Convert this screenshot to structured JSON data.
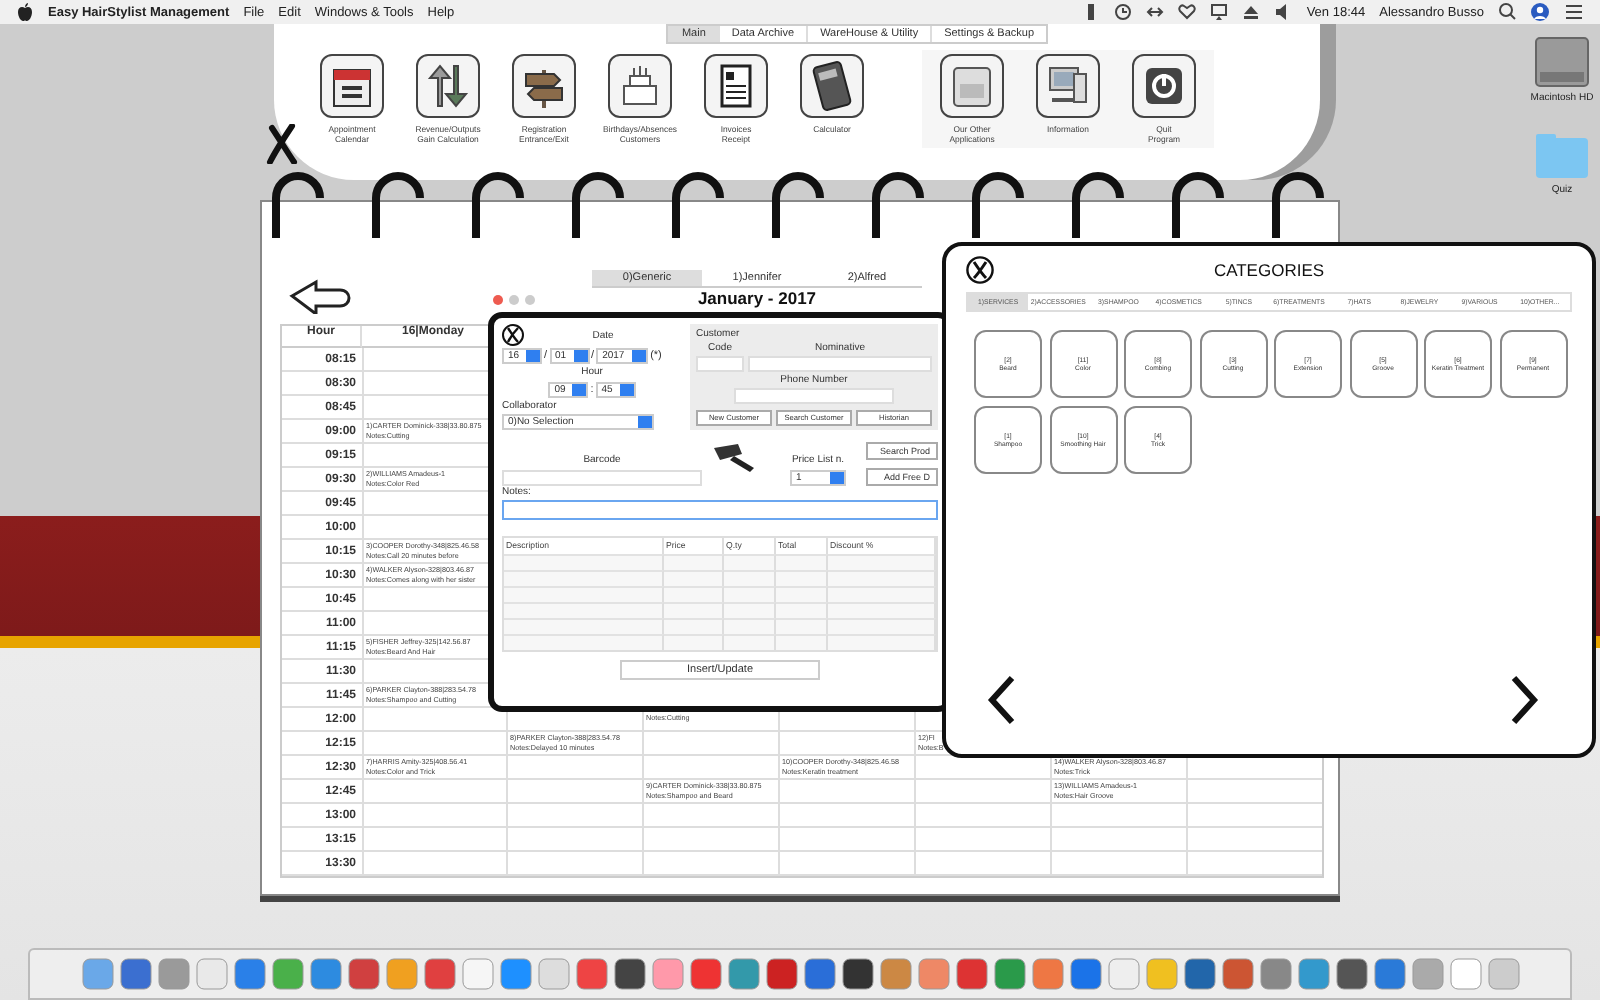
{
  "menubar": {
    "app": "Easy HairStylist Management",
    "menus": [
      "File",
      "Edit",
      "Windows & Tools",
      "Help"
    ],
    "clock": "Ven 18:44",
    "user": "Alessandro Busso"
  },
  "toolbar": {
    "tabs": [
      {
        "label": "Main",
        "selected": true
      },
      {
        "label": "Data Archive",
        "selected": false
      },
      {
        "label": "WareHouse & Utility",
        "selected": false
      },
      {
        "label": "Settings & Backup",
        "selected": false
      }
    ],
    "groups": [
      [
        {
          "lines": [
            "Appointment",
            "Calendar"
          ]
        },
        {
          "lines": [
            "Revenue/Outputs",
            "Gain Calculation"
          ]
        },
        {
          "lines": [
            "Registration",
            "Entrance/Exit"
          ]
        },
        {
          "lines": [
            "Birthdays/Absences",
            "Customers"
          ]
        },
        {
          "lines": [
            "Invoices",
            "Receipt"
          ]
        },
        {
          "lines": [
            "Calculator"
          ]
        }
      ],
      [
        {
          "lines": [
            "Our Other",
            "Applications"
          ]
        },
        {
          "lines": [
            "Information"
          ]
        },
        {
          "lines": [
            "Quit",
            "Program"
          ]
        }
      ]
    ]
  },
  "desktop_icons": [
    {
      "label": "Macintosh HD"
    },
    {
      "label": "Quiz"
    }
  ],
  "calendar": {
    "tabs": [
      {
        "label": "0)Generic",
        "selected": true
      },
      {
        "label": "1)Jennifer",
        "selected": false
      },
      {
        "label": "2)Alfred",
        "selected": false
      }
    ],
    "title": "January - 2017",
    "columns": [
      "Hour",
      "16|Monday"
    ],
    "rows": [
      {
        "hour": "08:15"
      },
      {
        "hour": "08:30"
      },
      {
        "hour": "08:45"
      },
      {
        "hour": "09:00",
        "column_2": {
          "name": "1)CARTER Dominick-338|33.80.875",
          "notes": "Notes:Cutting"
        }
      },
      {
        "hour": "09:15"
      },
      {
        "hour": "09:30",
        "column_2": {
          "name": "2)WILLIAMS Amadeus-1",
          "notes": "Notes:Color Red"
        }
      },
      {
        "hour": "09:45"
      },
      {
        "hour": "10:00"
      },
      {
        "hour": "10:15",
        "column_2": {
          "name": "3)COOPER Dorothy-348|825.46.58",
          "notes": "Notes:Call 20 minutes before"
        }
      },
      {
        "hour": "10:30",
        "column_2": {
          "name": "4)WALKER Alyson-328|803.46.87",
          "notes": "Notes:Comes along with her sister"
        }
      },
      {
        "hour": "10:45"
      },
      {
        "hour": "11:00"
      },
      {
        "hour": "11:15",
        "column_2": {
          "name": "5)FISHER Jeffrey-325|142.56.87",
          "notes": "Notes:Beard And Hair"
        }
      },
      {
        "hour": "11:30"
      },
      {
        "hour": "11:45",
        "column_2": {
          "name": "6)PARKER Clayton-388|283.54.78",
          "notes": "Notes:Shampoo and Cutting"
        }
      },
      {
        "hour": "12:00",
        "column_4": {
          "notes": "Notes:Cutting"
        }
      },
      {
        "hour": "12:15",
        "column_3": {
          "name": "8)PARKER Clayton-388|283.54.78",
          "notes": "Notes:Delayed 10 minutes"
        },
        "column_6": {
          "name": "12)FI",
          "notes": "Notes:B"
        }
      },
      {
        "hour": "12:30",
        "column_2": {
          "name": "7)HARRIS Amity-325|408.56.41",
          "notes": "Notes:Color and Trick"
        },
        "column_5": {
          "name": "10)COOPER Dorothy-348|825.46.58",
          "notes": "Notes:Keratin treatment"
        },
        "column_7": {
          "name": "14)WALKER Alyson-328|803.46.87",
          "notes": "Notes:Trick"
        }
      },
      {
        "hour": "12:45",
        "column_4": {
          "name": "9)CARTER Dominick-338|33.80.875",
          "notes": "Notes:Shampoo and Beard"
        },
        "column_7": {
          "name": "13)WILLIAMS Amadeus-1",
          "notes": "Notes:Hair Groove"
        }
      },
      {
        "hour": "13:00"
      },
      {
        "hour": "13:15"
      },
      {
        "hour": "13:30"
      }
    ]
  },
  "appointment_dialog": {
    "date_label": "Date",
    "day": "16",
    "month": "01",
    "year": "2017",
    "date_separators": [
      "/",
      "/"
    ],
    "required_mark": "(*)",
    "hour_label": "Hour",
    "hour": "09",
    "minute": "45",
    "time_separator": ":",
    "collaborator_label": "Collaborator",
    "collaborator": "0)No Selection",
    "customer": {
      "title": "Customer",
      "code_label": "Code",
      "nominative_label": "Nominative",
      "phone_label": "Phone Number",
      "buttons": [
        "New Customer",
        "Search Customer",
        "Historian"
      ]
    },
    "barcode_label": "Barcode",
    "price_list_label": "Price List n.",
    "price_list": "1",
    "side_buttons": [
      "Search Prod",
      "Add Free D"
    ],
    "notes_label": "Notes:",
    "table_columns": [
      "Description",
      "Price",
      "Q.ty",
      "Total",
      "Discount %"
    ],
    "insert_button": "Insert/Update"
  },
  "categories_dialog": {
    "title": "CATEGORIES",
    "tabs": [
      {
        "label": "1)SERVICES",
        "selected": true
      },
      {
        "label": "2)ACCESSORIES",
        "selected": false
      },
      {
        "label": "3)SHAMPOO",
        "selected": false
      },
      {
        "label": "4)COSMETICS",
        "selected": false
      },
      {
        "label": "5)TINCS",
        "selected": false
      },
      {
        "label": "6)TREATMENTS",
        "selected": false
      },
      {
        "label": "7)HATS",
        "selected": false
      },
      {
        "label": "8)JEWELRY",
        "selected": false
      },
      {
        "label": "9)VARIOUS",
        "selected": false
      },
      {
        "label": "10)OTHER...",
        "selected": false
      }
    ],
    "items": [
      {
        "code": "[2]",
        "name": "Beard"
      },
      {
        "code": "[11]",
        "name": "Color"
      },
      {
        "code": "[8]",
        "name": "Combing"
      },
      {
        "code": "[3]",
        "name": "Cutting"
      },
      {
        "code": "[7]",
        "name": "Extension"
      },
      {
        "code": "[5]",
        "name": "Groove"
      },
      {
        "code": "[6]",
        "name": "Keratin Treatment"
      },
      {
        "code": "[9]",
        "name": "Permanent"
      },
      {
        "code": "[1]",
        "name": "Shampoo"
      },
      {
        "code": "[10]",
        "name": "Smoothing Hair"
      },
      {
        "code": "[4]",
        "name": "Trick"
      }
    ]
  }
}
